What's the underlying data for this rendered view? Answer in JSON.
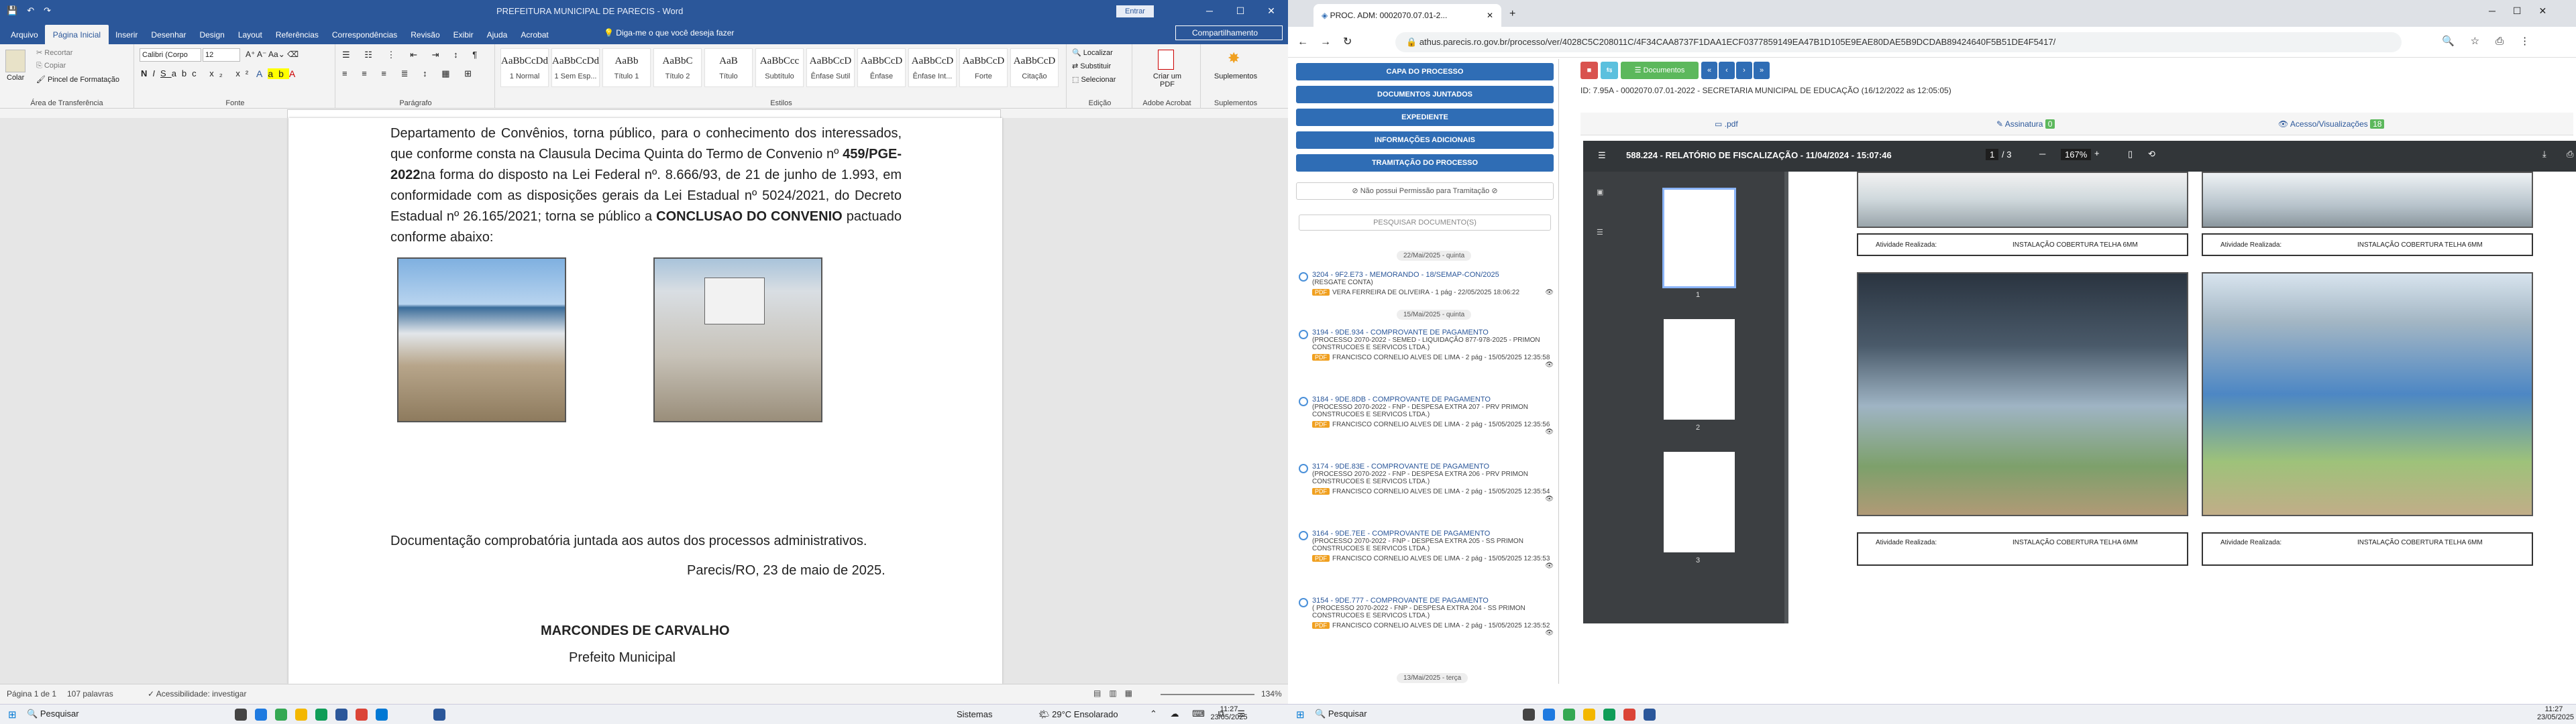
{
  "word": {
    "title": "PREFEITURA MUNICIPAL DE PARECIS - Word",
    "signin": "Entrar",
    "menu_tabs": [
      "Arquivo",
      "Página Inicial",
      "Inserir",
      "Desenhar",
      "Design",
      "Layout",
      "Referências",
      "Correspondências",
      "Revisão",
      "Exibir",
      "Ajuda",
      "Acrobat"
    ],
    "tellme": "Diga-me o que você deseja fazer",
    "share": "Compartilhamento",
    "clipboard": {
      "paste": "Colar",
      "cut": "Recortar",
      "copy": "Copiar",
      "format_painter": "Pincel de Formatação",
      "label": "Área de Transferência"
    },
    "font": {
      "family": "Calibri (Corpo",
      "size": "12",
      "label": "Fonte"
    },
    "paragraph_label": "Parágrafo",
    "styles": [
      {
        "preview": "AaBbCcDd",
        "name": "1 Normal"
      },
      {
        "preview": "AaBbCcDd",
        "name": "1 Sem Esp..."
      },
      {
        "preview": "AaBb",
        "name": "Título 1"
      },
      {
        "preview": "AaBbC",
        "name": "Título 2"
      },
      {
        "preview": "AaB",
        "name": "Título"
      },
      {
        "preview": "AaBbCcc",
        "name": "Subtítulo"
      },
      {
        "preview": "AaBbCcD",
        "name": "Ênfase Sutil"
      },
      {
        "preview": "AaBbCcD",
        "name": "Ênfase"
      },
      {
        "preview": "AaBbCcD",
        "name": "Ênfase Int..."
      },
      {
        "preview": "AaBbCcD",
        "name": "Forte"
      },
      {
        "preview": "AaBbCcD",
        "name": "Citação"
      }
    ],
    "styles_label": "Estilos",
    "editing": {
      "find": "Localizar",
      "replace": "Substituir",
      "select": "Selecionar",
      "label": "Edição"
    },
    "acrobat": {
      "create": "Criar um PDF",
      "label": "Adobe Acrobat"
    },
    "suplementos": {
      "name": "Suplementos",
      "label": "Suplementos"
    },
    "doc": {
      "para1_a": "Departamento de Convênios, torna público, para o conhecimento dos interessados, que conforme consta na Clausula Decima Quinta do Termo de Convenio nº ",
      "para1_bold": "459/PGE-2022",
      "para1_b": "na forma do disposto na Lei Federal nº. 8.666/93, de 21 de junho de 1.993, em conformidade com as disposições gerais da Lei Estadual nº 5024/2021, do Decreto Estadual nº 26.165/2021; torna se público a ",
      "para1_bold2": "CONCLUSAO DO CONVENIO",
      "para1_c": " pactuado conforme abaixo:",
      "para2": "Documentação comprobatória juntada aos autos dos processos administrativos.",
      "place_date": "Parecis/RO, 23 de maio de 2025.",
      "signer": "MARCONDES DE CARVALHO",
      "role": "Prefeito Municipal"
    },
    "status": {
      "page": "Página 1 de 1",
      "words": "107 palavras",
      "accessibility": "Acessibilidade: investigar",
      "zoom": "134%"
    }
  },
  "browser": {
    "tab_title": "PROC. ADM: 0002070.07.01-2...",
    "url": "athus.parecis.ro.gov.br/processo/ver/4028C5C208011C/4F34CAA8737F1DAA1ECF0377859149EA47B1D105E9EAE80DAE5B9DCDAB89424640F5B51DE4F5417/",
    "id_line": "ID: 7.95A - 0002070.07.01-2022 - SECRETARIA MUNICIPAL DE EDUCAÇÃO (16/12/2022 as 12:05:05)",
    "side_buttons": [
      "CAPA DO PROCESSO",
      "DOCUMENTOS JUNTADOS",
      "EXPEDIENTE",
      "INFORMAÇÕES ADICIONAIS",
      "TRAMITAÇÃO DO PROCESSO"
    ],
    "no_permission": "Não possui Permissão para Tramitação",
    "search_placeholder": "PESQUISAR DOCUMENTO(S)",
    "dates": [
      "22/Mai/2025 - quinta",
      "15/Mai/2025 - quinta",
      "13/Mai/2025 - terça"
    ],
    "items": [
      {
        "title": "3204 - 9F2.E73 - MEMORANDO - 18/SEMAP-CON/2025",
        "desc": "(RESGATE CONTA)",
        "tag": "PDF",
        "meta": "VERA FERREIRA DE OLIVEIRA - 1 pág - 22/05/2025 18:06:22"
      },
      {
        "title": "3194 - 9DE.934 - COMPROVANTE DE PAGAMENTO",
        "desc": "(PROCESSO 2070-2022 - SEMED - LIQUIDAÇÃO 877-978-2025 - PRIMON CONSTRUCOES E SERVICOS LTDA.)",
        "tag": "PDF",
        "meta": "FRANCISCO CORNELIO ALVES DE LIMA - 2 pág - 15/05/2025 12:35:58"
      },
      {
        "title": "3184 - 9DE.8DB - COMPROVANTE DE PAGAMENTO",
        "desc": "(PROCESSO 2070-2022 - FNP - DESPESA EXTRA 207 - PRV PRIMON CONSTRUCOES E SERVICOS LTDA.)",
        "tag": "PDF",
        "meta": "FRANCISCO CORNELIO ALVES DE LIMA - 2 pág - 15/05/2025 12:35:56"
      },
      {
        "title": "3174 - 9DE.83E - COMPROVANTE DE PAGAMENTO",
        "desc": "(PROCESSO 2070-2022 - FNP - DESPESA EXTRA 206 - PRV PRIMON CONSTRUCOES E SERVICOS LTDA.)",
        "tag": "PDF",
        "meta": "FRANCISCO CORNELIO ALVES DE LIMA - 2 pág - 15/05/2025 12:35:54"
      },
      {
        "title": "3164 - 9DE.7EE - COMPROVANTE DE PAGAMENTO",
        "desc": "(PROCESSO 2070-2022 - FNP - DESPESA EXTRA 205 - SS PRIMON CONSTRUCOES E SERVICOS LTDA.)",
        "tag": "PDF",
        "meta": "FRANCISCO CORNELIO ALVES DE LIMA - 2 pág - 15/05/2025 12:35:53"
      },
      {
        "title": "3154 - 9DE.777 - COMPROVANTE DE PAGAMENTO",
        "desc": "( PROCESSO 2070-2022 - FNP - DESPESA EXTRA 204 - SS PRIMON CONSTRUCOES E SERVICOS LTDA.)",
        "tag": "PDF",
        "meta": "FRANCISCO CORNELIO ALVES DE LIMA - 2 pág - 15/05/2025 12:35:52"
      }
    ],
    "toolbar": {
      "documentos": "Documentos"
    },
    "doc_tabs": [
      {
        "label": ".pdf"
      },
      {
        "label": "Assinatura",
        "count": "0"
      },
      {
        "label": "Acesso/Visualizações",
        "count": "18"
      }
    ],
    "pdf": {
      "title": "588.224 - RELATÓRIO DE FISCALIZAÇÃO - 11/04/2024 - 15:07:46",
      "page_current": "1",
      "page_total": "/ 3",
      "zoom": "167%",
      "thumb_labels": [
        "1",
        "2",
        "3"
      ],
      "table_label": "Atividade Realizada:",
      "table_value": "INSTALAÇÃO COBERTURA TELHA 6MM"
    }
  },
  "taskbar_left": {
    "search": "Pesquisar",
    "systems": "Sistemas",
    "weather": "29°C Ensolarado",
    "time": "11:27",
    "date": "23/05/2025"
  },
  "taskbar_right": {
    "search": "Pesquisar",
    "time": "11:27",
    "date": "23/05/2025"
  }
}
